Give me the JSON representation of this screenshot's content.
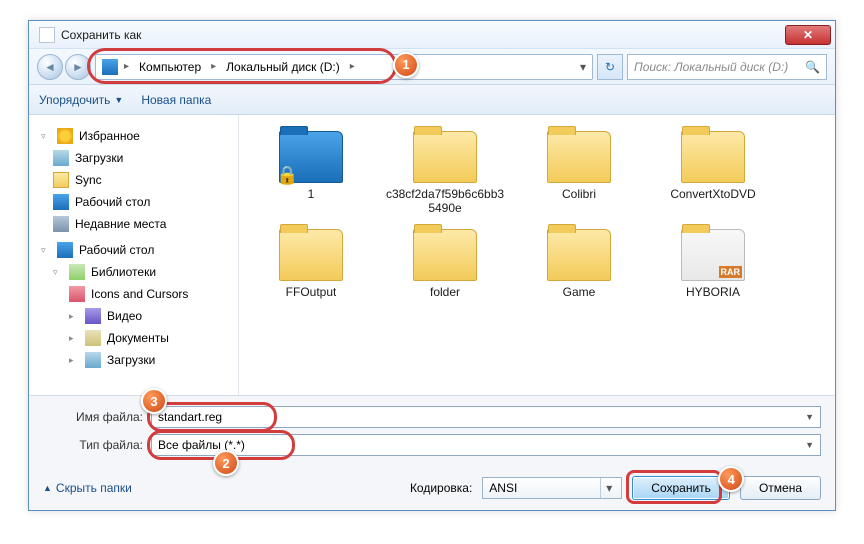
{
  "window": {
    "title": "Сохранить как"
  },
  "nav": {
    "crumb1": "Компьютер",
    "crumb2": "Локальный диск (D:)",
    "search_placeholder": "Поиск: Локальный диск (D:)"
  },
  "toolbar": {
    "organize": "Упорядочить",
    "newfolder": "Новая папка"
  },
  "sidebar": {
    "favorites": "Избранное",
    "downloads": "Загрузки",
    "sync": "Sync",
    "desktop": "Рабочий стол",
    "recent": "Недавние места",
    "desktop2": "Рабочий стол",
    "libraries": "Библиотеки",
    "icons": "Icons and Cursors",
    "video": "Видео",
    "docs": "Документы",
    "dl2": "Загрузки"
  },
  "files": [
    {
      "name": "1",
      "kind": "special lock"
    },
    {
      "name": "c38cf2da7f59b6c6bb35490e",
      "kind": ""
    },
    {
      "name": "Colibri",
      "kind": ""
    },
    {
      "name": "ConvertXtoDVD",
      "kind": ""
    },
    {
      "name": "FFOutput",
      "kind": ""
    },
    {
      "name": "folder",
      "kind": ""
    },
    {
      "name": "Game",
      "kind": ""
    },
    {
      "name": "HYBORIA",
      "kind": "rar"
    }
  ],
  "fields": {
    "name_label": "Имя файла:",
    "name_value": "standart.reg",
    "type_label": "Тип файла:",
    "type_value": "Все файлы (*.*)"
  },
  "footer": {
    "hide": "Скрыть папки",
    "encoding_label": "Кодировка:",
    "encoding_value": "ANSI",
    "save": "Сохранить",
    "cancel": "Отмена"
  },
  "bubbles": {
    "b1": "1",
    "b2": "2",
    "b3": "3",
    "b4": "4"
  }
}
